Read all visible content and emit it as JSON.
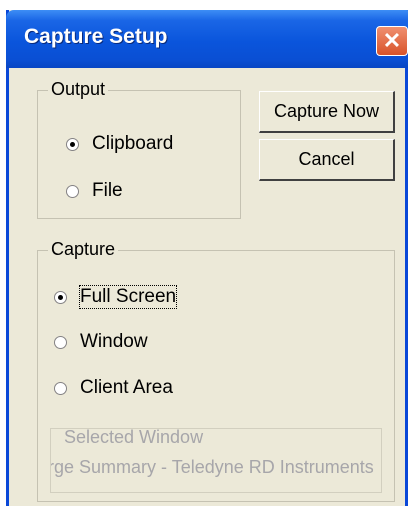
{
  "window": {
    "title": "Capture Setup",
    "close_glyph": "✕"
  },
  "output_group": {
    "label": "Output",
    "options": [
      {
        "label": "Clipboard",
        "checked": true
      },
      {
        "label": "File",
        "checked": false
      }
    ]
  },
  "buttons": {
    "capture_now": "Capture Now",
    "cancel": "Cancel"
  },
  "capture_group": {
    "label": "Capture",
    "options": [
      {
        "label": "Full Screen",
        "checked": true
      },
      {
        "label": "Window",
        "checked": false
      },
      {
        "label": "Client Area",
        "checked": false
      }
    ]
  },
  "selected_window": {
    "label": "Selected Window",
    "value": "Discharge Summary - Teledyne RD Instruments"
  },
  "colors": {
    "titlebar": "#0a55dc",
    "dialog_bg": "#ece9d8",
    "close_button": "#d8532a"
  }
}
